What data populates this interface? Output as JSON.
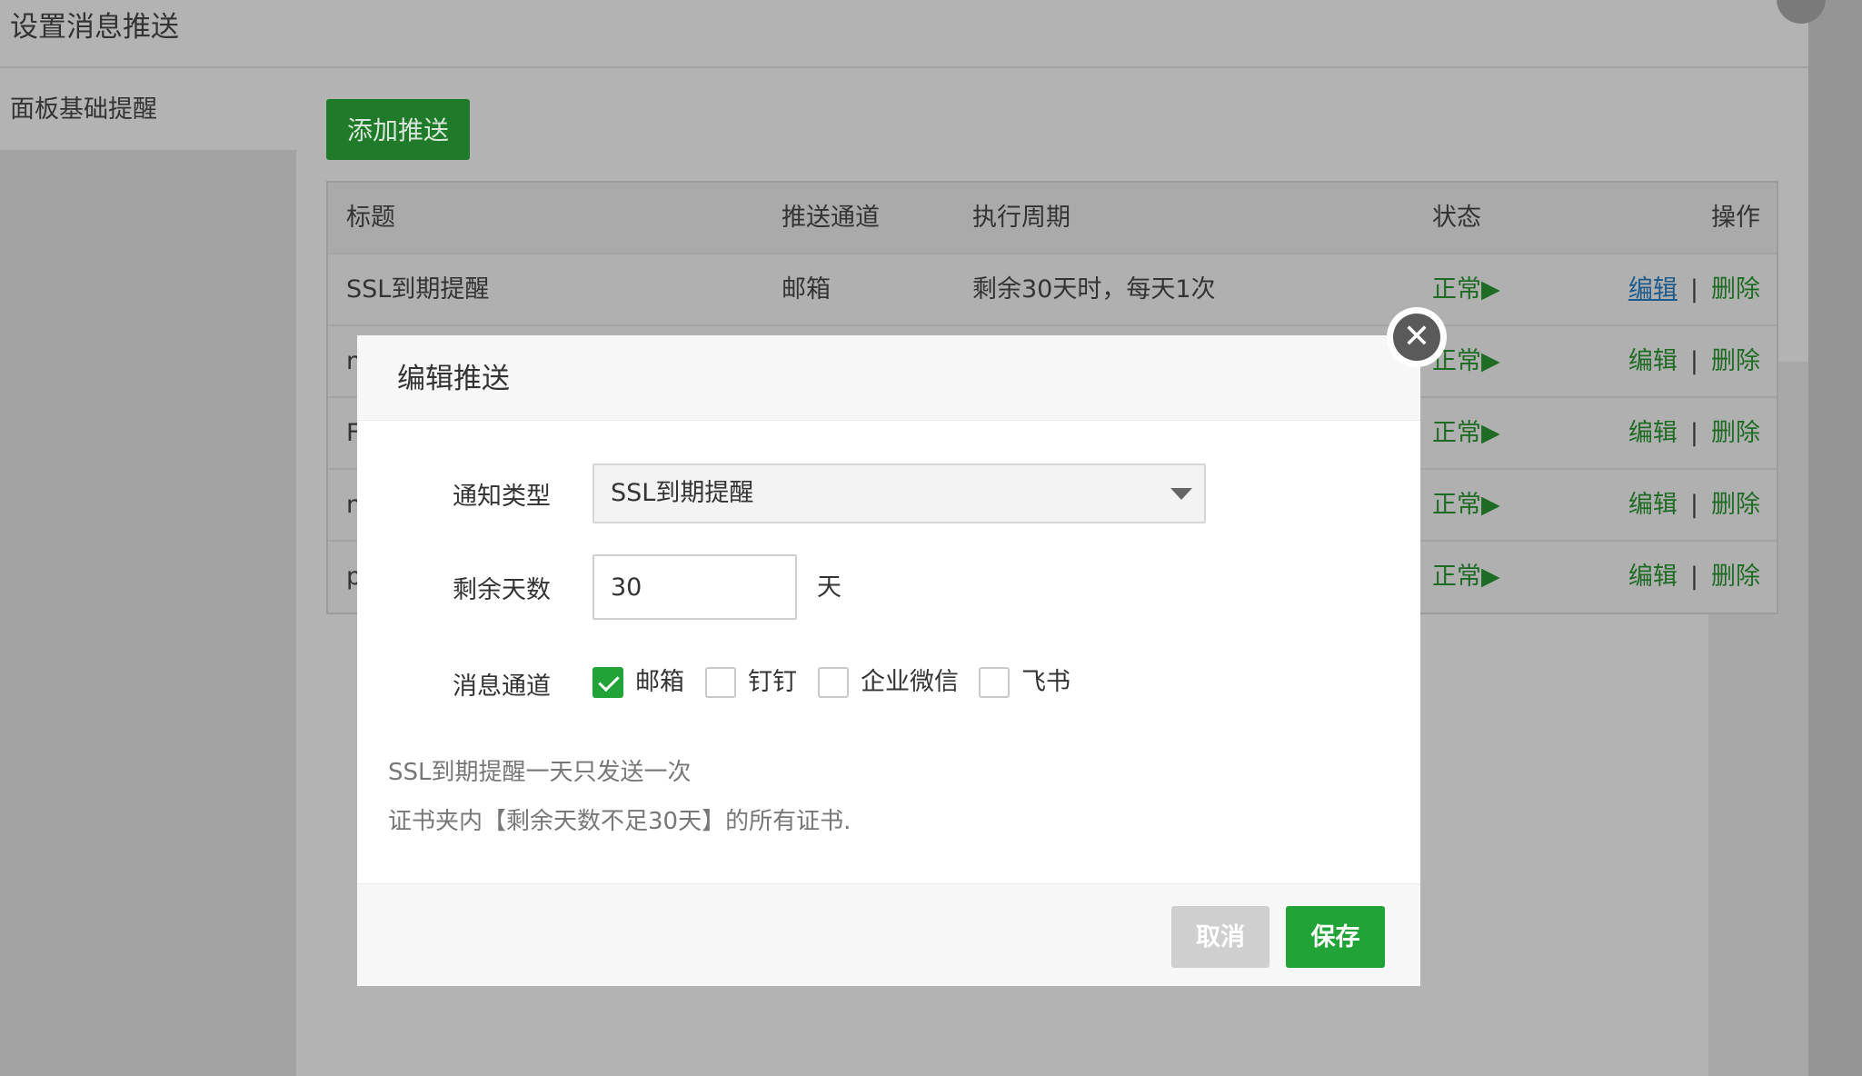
{
  "page": {
    "title": "设置消息推送"
  },
  "sidebar": {
    "items": [
      {
        "label": "面板基础提醒"
      }
    ]
  },
  "toolbar": {
    "add_label": "添加推送"
  },
  "table": {
    "headers": {
      "title": "标题",
      "channel": "推送通道",
      "period": "执行周期",
      "status": "状态",
      "ops": "操作"
    },
    "rows": [
      {
        "title": "SSL到期提醒",
        "channel": "邮箱",
        "period": "剩余30天时，每天1次",
        "status": "正常▶",
        "edit": "编辑",
        "delete": "删除"
      },
      {
        "title": "n",
        "channel": "",
        "period": "",
        "status": "正常▶",
        "edit": "编辑",
        "delete": "删除"
      },
      {
        "title": "F",
        "channel": "",
        "period": "",
        "status": "正常▶",
        "edit": "编辑",
        "delete": "删除"
      },
      {
        "title": "n",
        "channel": "",
        "period": "",
        "status": "正常▶",
        "edit": "编辑",
        "delete": "删除"
      },
      {
        "title": "p",
        "channel": "",
        "period": "",
        "status": "正常▶",
        "edit": "编辑",
        "delete": "删除"
      }
    ],
    "separator": "|"
  },
  "modal": {
    "title": "编辑推送",
    "close_symbol": "✕",
    "notify_type_label": "通知类型",
    "notify_type_value": "SSL到期提醒",
    "days_label": "剩余天数",
    "days_value": "30",
    "days_unit": "天",
    "channel_label": "消息通道",
    "channels": [
      {
        "label": "邮箱",
        "checked": true
      },
      {
        "label": "钉钉",
        "checked": false
      },
      {
        "label": "企业微信",
        "checked": false
      },
      {
        "label": "飞书",
        "checked": false
      }
    ],
    "help_line1": "SSL到期提醒一天只发送一次",
    "help_line2": "证书夹内【剩余天数不足30天】的所有证书.",
    "cancel_label": "取消",
    "save_label": "保存"
  },
  "colors": {
    "accent": "#21a337",
    "overlay": "#b3b3b3"
  }
}
